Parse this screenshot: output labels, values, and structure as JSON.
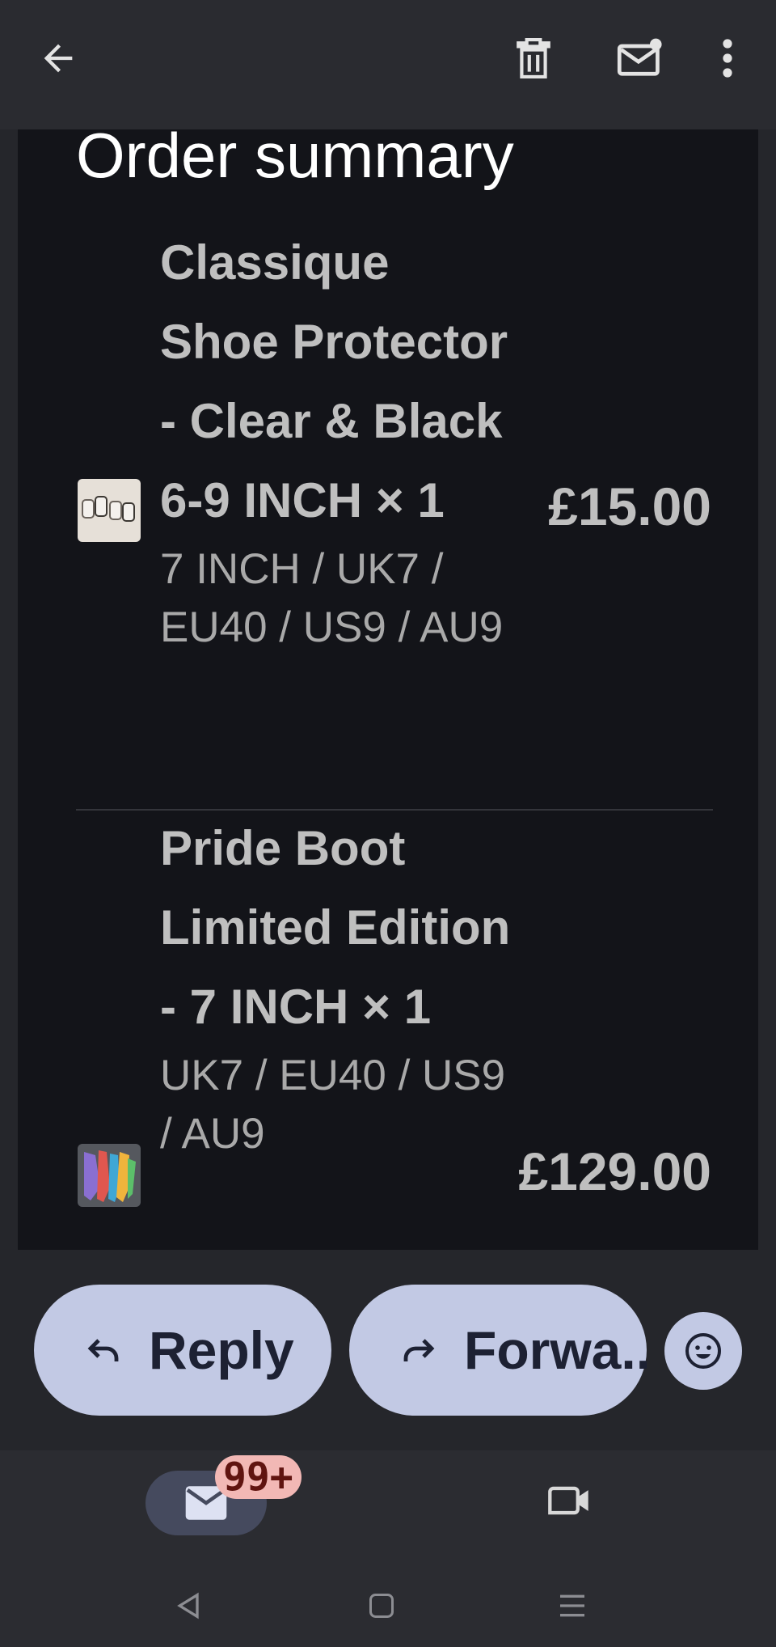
{
  "toolbar": {
    "back_icon": "arrow-left-icon",
    "delete_icon": "trash-icon",
    "mark_unread_icon": "mail-unread-icon",
    "more_icon": "more-vertical-icon"
  },
  "email": {
    "section_title": "Order summary",
    "items": [
      {
        "name": "Classique Shoe Protector - Clear & Black 6-9 INCH × 1",
        "variant": "7 INCH / UK7 / EU40 / US9 / AU9",
        "price": "£15.00"
      },
      {
        "name": "Pride Boot Limited Edition - 7 INCH × 1",
        "variant": "UK7 / EU40 / US9 / AU9",
        "price": "£129.00"
      }
    ]
  },
  "actions": {
    "reply_label": "Reply",
    "forward_label": "Forwa...",
    "emoji_icon": "smiley-icon"
  },
  "bottom_nav": {
    "mail_icon": "mail-icon",
    "badge": "99+",
    "meet_icon": "video-icon"
  },
  "system_nav": {
    "back": "triangle-back-icon",
    "home": "square-home-icon",
    "recents": "lines-recents-icon"
  },
  "colors": {
    "pill_bg": "#c2c9e4",
    "content_bg": "#131419",
    "badge_bg": "#f2b8b5"
  }
}
